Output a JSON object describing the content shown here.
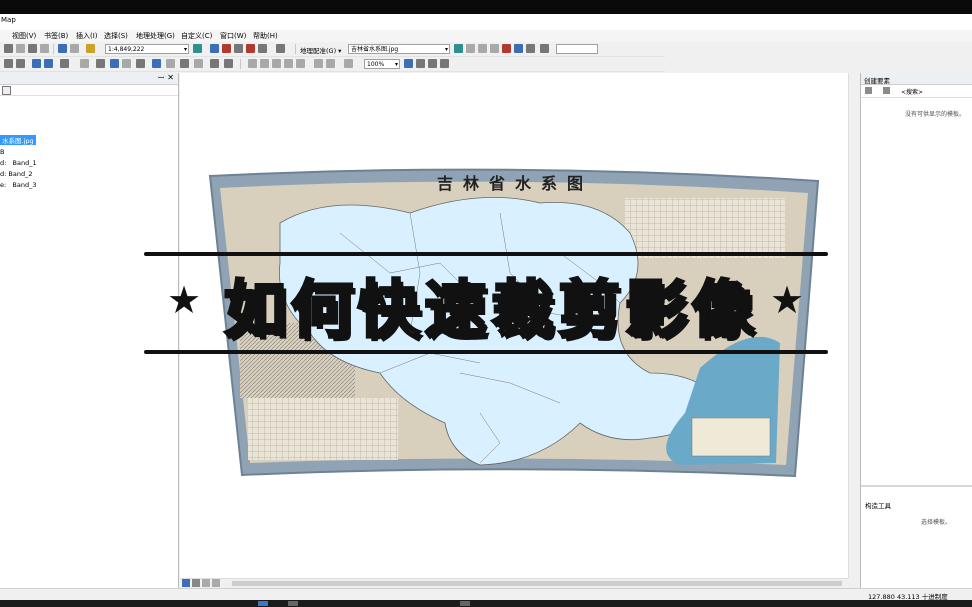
{
  "window": {
    "title": "Map"
  },
  "menu": [
    "",
    "视图(V)",
    "书签(B)",
    "插入(I)",
    "选择(S)",
    "地理处理(G)",
    "自定义(C)",
    "窗口(W)",
    "帮助(H)"
  ],
  "toolbar": {
    "scale": "1:4,849,222",
    "georef_label": "地理配准(G) ▾",
    "layer_select": "吉林省水系图.jpg",
    "zoom_level": "100%"
  },
  "toc": {
    "title_icon": "layers-icon",
    "items": [
      {
        "label": "水系图.jpg",
        "selected": true
      },
      {
        "label": "B"
      },
      {
        "label": "Band_1",
        "prefix": "d:"
      },
      {
        "label": "Band_2",
        "prefix": "d:"
      },
      {
        "label": "Band_3",
        "prefix": "e:"
      }
    ]
  },
  "right_panel": {
    "title": "创建要素",
    "search_label": "<搜索>",
    "empty_msg": "没有可供显示的模板。",
    "tool_title": "构造工具",
    "tool_msg": "选择模板。"
  },
  "map": {
    "map_title": "吉林省水系图",
    "banner_chars": [
      {
        "ch": "如",
        "color": "#f0c419"
      },
      {
        "ch": "何",
        "color": "#2f80ed"
      },
      {
        "ch": "快",
        "color": "#e53935"
      },
      {
        "ch": "速",
        "color": "#27ae60"
      },
      {
        "ch": "裁",
        "color": "#f2b705"
      },
      {
        "ch": "剪",
        "color": "#2f80ed"
      },
      {
        "ch": "影",
        "color": "#e53935"
      },
      {
        "ch": "像",
        "color": "#27ae60"
      }
    ],
    "star": "★"
  },
  "status": {
    "coords": "127.880  43.113 十进制度"
  },
  "colors": {
    "accent": "#3399ff",
    "map_bg": "#c8d8e4",
    "water": "#d8f0ff"
  }
}
